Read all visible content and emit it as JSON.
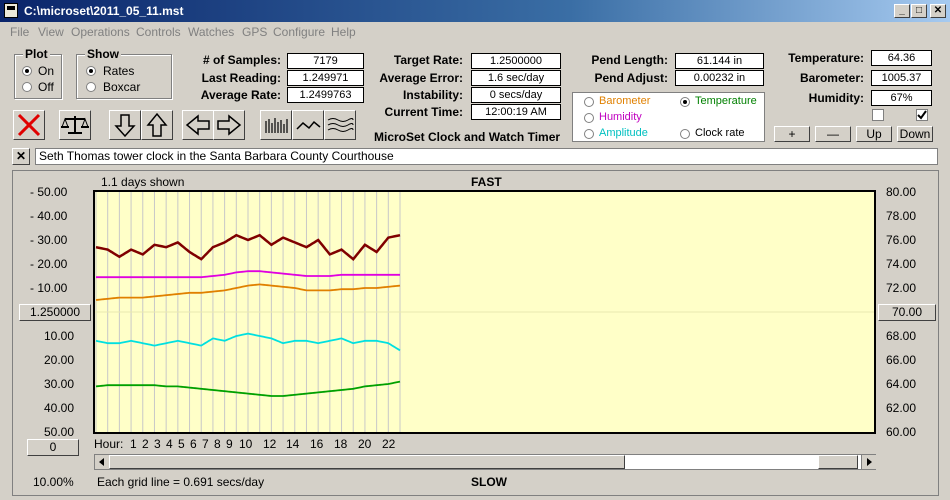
{
  "window": {
    "title": "C:\\microset\\2011_05_11.mst"
  },
  "menu": [
    "File",
    "View",
    "Operations",
    "Controls",
    "Watches",
    "GPS",
    "Configure",
    "Help"
  ],
  "plot_group": {
    "title": "Plot",
    "on_label": "On",
    "off_label": "Off",
    "selected": "On"
  },
  "show_group": {
    "title": "Show",
    "rates_label": "Rates",
    "boxcar_label": "Boxcar",
    "selected": "Rates"
  },
  "stats": {
    "samples_label": "# of Samples:",
    "samples_value": "7179",
    "last_label": "Last Reading:",
    "last_value": "1.249971",
    "avg_rate_label": "Average Rate:",
    "avg_rate_value": "1.2499763",
    "target_label": "Target Rate:",
    "target_value": "1.2500000",
    "avg_err_label": "Average Error:",
    "avg_err_value": "1.6 sec/day",
    "instab_label": "Instability:",
    "instab_value": "0 secs/day",
    "time_label": "Current Time:",
    "time_value": "12:00:19 AM",
    "pend_len_label": "Pend Length:",
    "pend_len_value": "61.144 in",
    "pend_adj_label": "Pend Adjust:",
    "pend_adj_value": "0.00232 in",
    "temp_label": "Temperature:",
    "temp_value": "64.36",
    "baro_label": "Barometer:",
    "baro_value": "1005.37",
    "hum_label": "Humidity:",
    "hum_value": "67%"
  },
  "app_caption": "MicroSet Clock and Watch Timer",
  "secondary": {
    "barometer": "Barometer",
    "temperature": "Temperature",
    "humidity": "Humidity",
    "amplitude": "Amplitude",
    "clock_rate": "Clock rate",
    "selected": "Temperature",
    "colors": {
      "barometer": "#e08000",
      "temperature": "#008000",
      "humidity": "#c000c0",
      "amplitude": "#00c0c0",
      "clock_rate": "#000000"
    }
  },
  "panel_buttons": {
    "plus": "+",
    "minus": "—",
    "up": "Up",
    "down": "Down"
  },
  "description": "Seth Thomas tower clock in the Santa Barbara County Courthouse",
  "chart": {
    "days_shown": "1.1 days shown",
    "fast_label": "FAST",
    "slow_label": "SLOW",
    "left_ticks": [
      "- 50.00",
      "- 40.00",
      "- 30.00",
      "- 20.00",
      "- 10.00",
      "10.00",
      "20.00",
      "30.00",
      "40.00",
      "50.00"
    ],
    "right_ticks": [
      "80.00",
      "78.00",
      "76.00",
      "74.00",
      "72.00",
      "68.00",
      "66.00",
      "64.00",
      "62.00",
      "60.00"
    ],
    "center_left": "1.250000",
    "center_right": "70.00",
    "zero_button": "0",
    "hour_label": "Hour:",
    "hours": [
      "1",
      "2",
      "3",
      "4",
      "5",
      "6",
      "7",
      "8",
      "9",
      "10",
      "12",
      "14",
      "16",
      "18",
      "20",
      "22"
    ],
    "scale_pct": "10.00%",
    "grid_note": "Each grid line = 0.691 secs/day"
  },
  "chart_data": {
    "type": "line",
    "x_label": "Hour",
    "x": [
      0,
      1,
      2,
      3,
      4,
      5,
      6,
      7,
      8,
      9,
      10,
      11,
      12,
      13,
      14,
      15,
      16,
      17,
      18,
      19,
      20,
      21,
      22,
      23,
      24,
      25,
      26
    ],
    "ylim_left": [
      -50,
      50
    ],
    "ylim_right": [
      60,
      80
    ],
    "series": [
      {
        "color": "#800000",
        "values": [
          -27,
          -26,
          -23,
          -26,
          -24,
          -28,
          -27,
          -29,
          -25,
          -22,
          -27,
          -29,
          -32,
          -30,
          -32,
          -28,
          -31,
          -29,
          -27,
          -30,
          -24,
          -26,
          -22,
          -28,
          -25,
          -31,
          -32
        ]
      },
      {
        "color": "#e000e0",
        "values": [
          -14.5,
          -14.5,
          -14.5,
          -14.5,
          -14.5,
          -14.5,
          -14.5,
          -14.5,
          -14.5,
          -14.5,
          -15,
          -15.5,
          -16.5,
          -17,
          -17,
          -16.5,
          -16,
          -15.5,
          -15,
          -15,
          -15,
          -15.5,
          -15.5,
          -15.5,
          -15.5,
          -15.5,
          -15.5
        ]
      },
      {
        "color": "#e08000",
        "values": [
          -5,
          -5.5,
          -6,
          -6,
          -6,
          -6.5,
          -7,
          -7.5,
          -8,
          -8,
          -8.5,
          -9,
          -10,
          -11,
          -11.5,
          -11,
          -10.5,
          -10,
          -9,
          -9,
          -9,
          -9.5,
          -9.5,
          -10,
          -10,
          -10.5,
          -11
        ]
      },
      {
        "color": "#00e0e0",
        "values": [
          12,
          13,
          13,
          12,
          13,
          14,
          13,
          12,
          13,
          14,
          11,
          12,
          10,
          9,
          10,
          11,
          13,
          12,
          12,
          13,
          12,
          11,
          13,
          12,
          12,
          13,
          16
        ]
      },
      {
        "color": "#00a000",
        "values": [
          31,
          30.5,
          30.5,
          30.5,
          30.5,
          30.5,
          31,
          31,
          31.5,
          32,
          32.5,
          33,
          33.5,
          34,
          34.5,
          35,
          35,
          34.5,
          34,
          33.5,
          33,
          32.5,
          32,
          31,
          30.5,
          30,
          29
        ]
      }
    ]
  }
}
